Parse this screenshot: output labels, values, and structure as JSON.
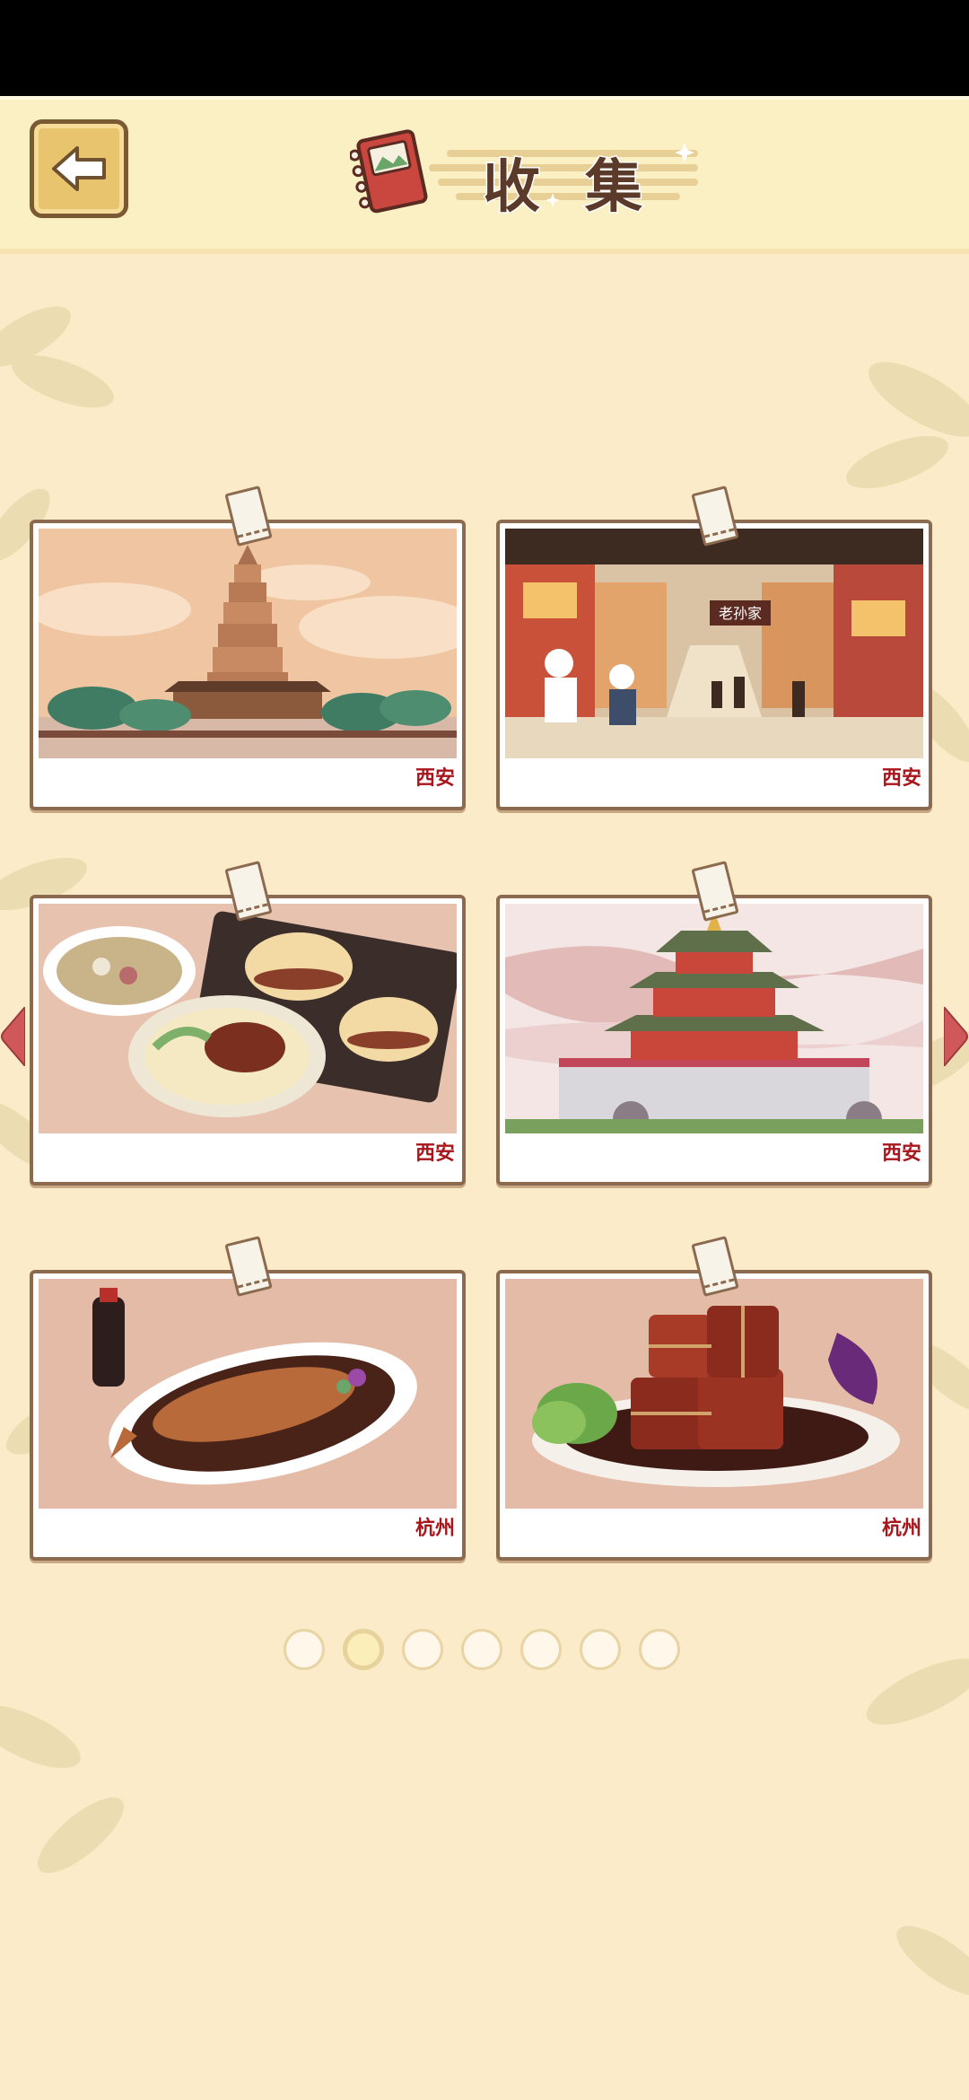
{
  "header": {
    "title": "收集",
    "back_icon": "arrow-left-icon",
    "title_icon": "notebook-icon"
  },
  "colors": {
    "background": "#fcebc8",
    "header": "#fbefc4",
    "card_border": "#8b6a4f",
    "city_label": "#a8161c"
  },
  "collection": {
    "cards": [
      {
        "city": "西安",
        "art": "giant-wild-goose-pagoda"
      },
      {
        "city": "西安",
        "art": "muslim-street-market",
        "sign": "老孙家"
      },
      {
        "city": "西安",
        "art": "roujiamo-and-noodles"
      },
      {
        "city": "西安",
        "art": "bell-tower"
      },
      {
        "city": "杭州",
        "art": "west-lake-fish-in-vinegar"
      },
      {
        "city": "杭州",
        "art": "dongpo-pork"
      }
    ]
  },
  "pager": {
    "total": 7,
    "current": 2
  },
  "nav": {
    "prev_icon": "triangle-left-icon",
    "next_icon": "triangle-right-icon"
  }
}
